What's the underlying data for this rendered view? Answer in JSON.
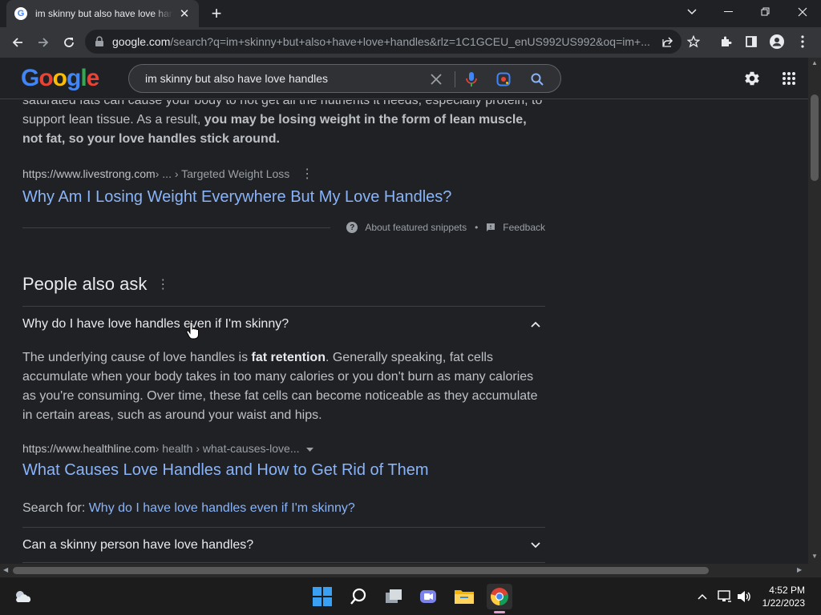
{
  "browser": {
    "tab_title": "im skinny but also have love handles - Google Search",
    "favicon_letter": "G",
    "url_host": "google.com",
    "url_path": "/search?q=im+skinny+but+also+have+love+handles&rlz=1C1GCEU_enUS992US992&oq=im+..."
  },
  "google": {
    "logo_text": "Google",
    "query": "im skinny but also have love handles"
  },
  "featured_snippet": {
    "text_start": "saturated fats can cause your body to not get all the nutrients it needs, especially protein, to support lean tissue. As a result, ",
    "text_bold": "you may be losing weight in the form of lean muscle, not fat, so your love handles stick around.",
    "cite_host": "https://www.livestrong.com",
    "cite_path": " › ... › Targeted Weight Loss",
    "link_title": "Why Am I Losing Weight Everywhere But My Love Handles?",
    "about_label": "About featured snippets",
    "feedback_label": "Feedback"
  },
  "people_also_ask": {
    "heading": "People also ask",
    "expanded": {
      "question": "Why do I have love handles even if I'm skinny?",
      "answer_start": "The underlying cause of love handles is ",
      "answer_bold": "fat retention",
      "answer_end": ". Generally speaking, fat cells accumulate when your body takes in too many calories or you don't burn as many calories as you're consuming. Over time, these fat cells can become noticeable as they accumulate in certain areas, such as around your waist and hips.",
      "cite_host": "https://www.healthline.com",
      "cite_path": " › health › what-causes-love...",
      "link_title": "What Causes Love Handles and How to Get Rid of Them",
      "search_for_label": "Search for: ",
      "search_for_link": "Why do I have love handles even if I'm skinny?"
    },
    "collapsed": [
      {
        "question": "Can a skinny person have love handles?"
      }
    ]
  },
  "taskbar": {
    "time": "4:52 PM",
    "date": "1/22/2023"
  },
  "colors": {
    "background": "#202124",
    "link": "#8ab4f8",
    "text": "#bdc1c6"
  }
}
